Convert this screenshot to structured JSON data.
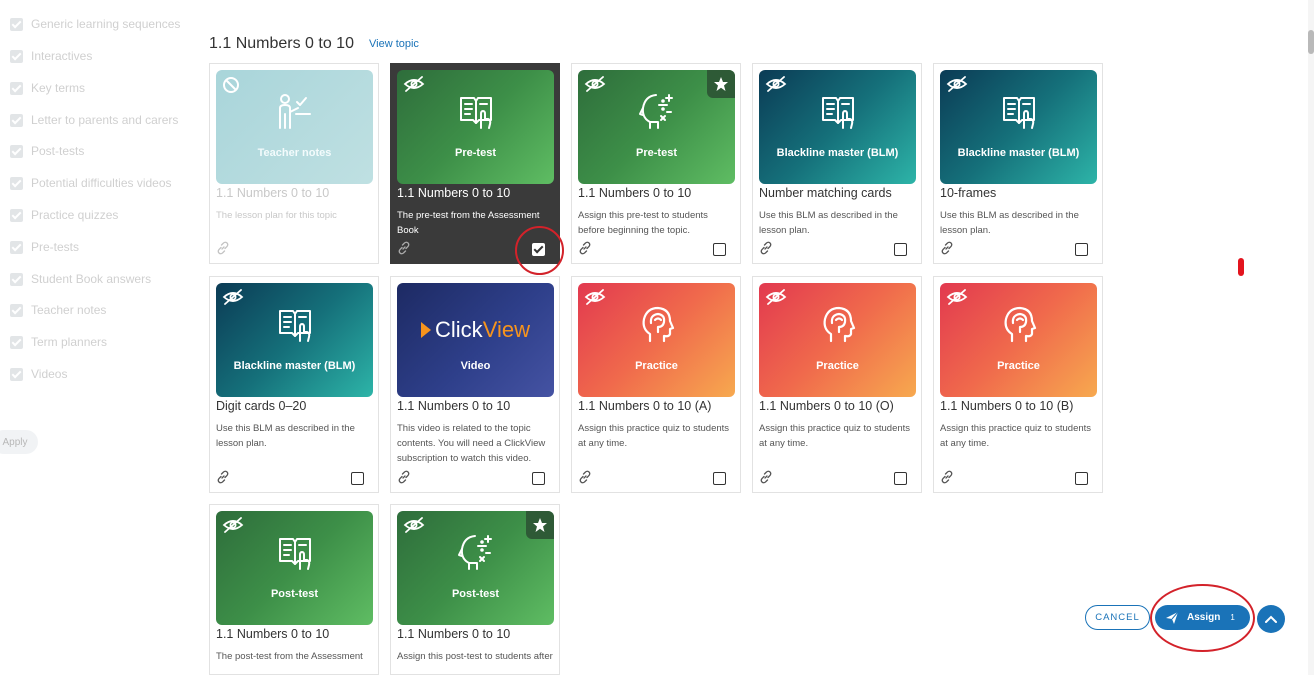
{
  "sidebar": {
    "filters": [
      "Generic learning sequences",
      "Interactives",
      "Key terms",
      "Letter to parents and carers",
      "Post-tests",
      "Potential difficulties videos",
      "Practice quizzes",
      "Pre-tests",
      "Student Book answers",
      "Teacher notes",
      "Term planners",
      "Videos"
    ],
    "apply_label": "Apply"
  },
  "topic": {
    "title": "1.1 Numbers 0 to 10",
    "view_link": "View topic"
  },
  "cards": [
    {
      "thumb_label": "Teacher notes",
      "icon": "teacher-icon",
      "title": "1.1 Numbers 0 to 10",
      "desc": "The lesson plan for this topic",
      "state": "muted",
      "badge": "ban"
    },
    {
      "thumb_label": "Pre-test",
      "icon": "book-icon",
      "title": "1.1 Numbers 0 to 10",
      "desc": "The pre-test from the Assessment Book",
      "state": "selected",
      "badge": "hidden"
    },
    {
      "thumb_label": "Pre-test",
      "icon": "head-math-icon",
      "title": "1.1 Numbers 0 to 10",
      "desc": "Assign this pre-test to students before beginning the topic.",
      "state": "normal",
      "badge": "hidden",
      "star": true
    },
    {
      "thumb_label": "Blackline master (BLM)",
      "icon": "book-icon",
      "title": "Number matching cards",
      "desc": "Use this BLM as described in the lesson plan.",
      "state": "normal",
      "badge": "hidden"
    },
    {
      "thumb_label": "Blackline master (BLM)",
      "icon": "book-icon",
      "title": "10-frames",
      "desc": "Use this BLM as described in the lesson plan.",
      "state": "normal",
      "badge": "hidden"
    },
    {
      "thumb_label": "Blackline master (BLM)",
      "icon": "book-icon",
      "title": "Digit cards 0–20",
      "desc": "Use this BLM as described in the lesson plan.",
      "state": "normal",
      "badge": "hidden"
    },
    {
      "thumb_label": "Video",
      "icon": "clickview-logo",
      "logo_text_a": "Click",
      "logo_text_b": "View",
      "title": "1.1 Numbers 0 to 10",
      "desc": "This video is related to the topic contents. You will need a ClickView subscription to watch this video.",
      "state": "normal",
      "badge": "none"
    },
    {
      "thumb_label": "Practice",
      "icon": "head-brain-icon",
      "title": "1.1 Numbers 0 to 10 (A)",
      "desc": "Assign this practice quiz to students at any time.",
      "state": "normal",
      "badge": "hidden"
    },
    {
      "thumb_label": "Practice",
      "icon": "head-brain-icon",
      "title": "1.1 Numbers 0 to 10 (O)",
      "desc": "Assign this practice quiz to students at any time.",
      "state": "normal",
      "badge": "hidden"
    },
    {
      "thumb_label": "Practice",
      "icon": "head-brain-icon",
      "title": "1.1 Numbers 0 to 10 (B)",
      "desc": "Assign this practice quiz to students at any time.",
      "state": "normal",
      "badge": "hidden"
    },
    {
      "thumb_label": "Post-test",
      "icon": "book-icon",
      "title": "1.1 Numbers 0 to 10",
      "desc": "The post-test from the Assessment",
      "state": "normal",
      "badge": "hidden"
    },
    {
      "thumb_label": "Post-test",
      "icon": "head-math-icon",
      "title": "1.1 Numbers 0 to 10",
      "desc": "Assign this post-test to students after",
      "state": "normal",
      "badge": "hidden",
      "star": true
    }
  ],
  "actions": {
    "cancel_label": "CANCEL",
    "assign_label": "Assign",
    "assign_count": "1"
  },
  "colors": {
    "accent": "#1a73b8",
    "annotation_red": "#d3222a",
    "green_start": "#2e6d3b",
    "teal_start": "#0b3b55",
    "red_start": "#e2394f",
    "navy_start": "#1d2a63"
  }
}
